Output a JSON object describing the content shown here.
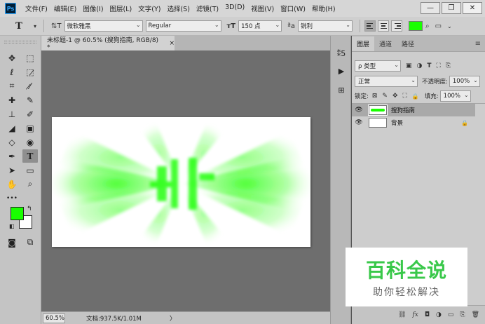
{
  "app": {
    "logo": "Ps",
    "menu": [
      "文件(F)",
      "编辑(E)",
      "图像(I)",
      "图层(L)",
      "文字(Y)",
      "选择(S)",
      "滤镜(T)",
      "3D(D)",
      "视图(V)",
      "窗口(W)",
      "帮助(H)"
    ],
    "window_buttons": {
      "minimize": "—",
      "restore": "❐",
      "close": "✕"
    }
  },
  "options": {
    "tool_glyph": "T",
    "orientation_glyph": "⇅T",
    "font_family": "微软雅黑",
    "font_style": "Regular",
    "size_glyph": "ᴛT",
    "font_size": "150 点",
    "aa_glyph": "ªa",
    "antialias": "锐利",
    "text_color": "#19ff00",
    "warp_glyph": "⌕",
    "panel_glyph": "▭"
  },
  "document": {
    "tab_title": "未标题-1 @ 60.5% (搜狗指南, RGB/8) *",
    "tab_close": "×",
    "zoom": "60.5%",
    "doc_info": "文档:937.5K/1.01M",
    "status_arrow": "〉"
  },
  "tools": {
    "glyphs": [
      "✥",
      "⬚",
      "ℓ",
      "⬚̷",
      "⌗",
      "⁄̷",
      "✚",
      "✎",
      "⊥",
      "✐",
      "◢",
      "▣",
      "◇",
      "◉",
      "✒",
      "T",
      "➤",
      "▭",
      "✋",
      "⌕",
      "•••",
      ""
    ],
    "swap": "↰",
    "default": "◧",
    "quickmask": "◙",
    "screen": "⧉"
  },
  "dock": [
    "⁑5",
    "▶",
    "⊞"
  ],
  "layers_panel": {
    "tabs": [
      "图层",
      "通道",
      "路径"
    ],
    "menu_glyph": "≡",
    "filter_kind": "ρ 类型",
    "filter_icons": [
      "▣",
      "◑",
      "T",
      "⛶",
      "⎘"
    ],
    "blend_mode": "正常",
    "opacity_label": "不透明度:",
    "opacity": "100%",
    "lock_label": "锁定:",
    "lock_icons": [
      "⊠",
      "✎",
      "✥",
      "⛶",
      "🔒"
    ],
    "fill_label": "填充:",
    "fill": "100%",
    "layers": [
      {
        "name": "搜狗指南",
        "selected": true
      },
      {
        "name": "背景",
        "selected": false,
        "locked": "🔒"
      }
    ],
    "eye_glyph": "👁",
    "footer_icons": [
      "⛓",
      "fx",
      "◘",
      "◑",
      "▭",
      "⎘",
      "🗑"
    ]
  },
  "watermark": {
    "title": "百科全说",
    "subtitle": "助你轻松解决"
  }
}
